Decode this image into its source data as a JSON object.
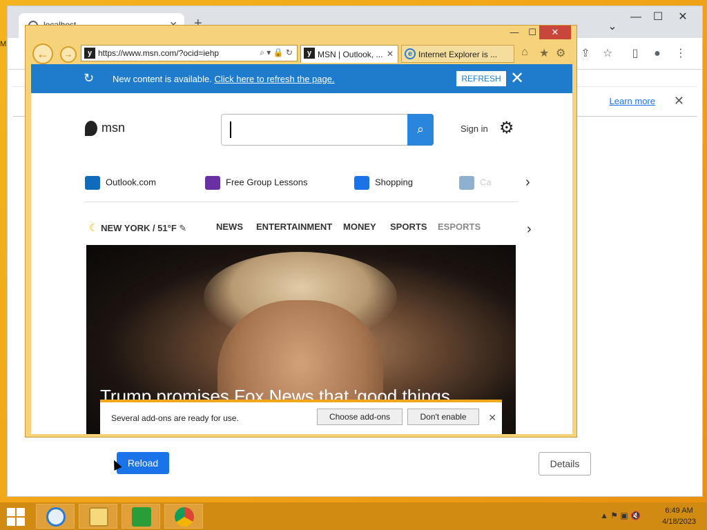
{
  "chrome": {
    "tab_title": "localhost",
    "infobar": {
      "learn_more": "Learn more"
    },
    "reload_label": "Reload",
    "details_label": "Details",
    "side_text": "M"
  },
  "ie": {
    "address": "https://www.msn.com/?ocid=iehp",
    "tabs": [
      {
        "label": "MSN | Outlook, ..."
      },
      {
        "label": "Internet Explorer is ..."
      }
    ],
    "notice": {
      "text": "New content is available.",
      "link": "Click here to refresh the page.",
      "refresh_button": "REFRESH"
    },
    "addons": {
      "text": "Several add-ons are ready for use.",
      "choose_button": "Choose add-ons",
      "dont_enable_button": "Don't enable"
    }
  },
  "msn": {
    "logo_text": "msn",
    "sign_in": "Sign in",
    "quicklinks": [
      {
        "label": "Outlook.com",
        "icon": "outlook-icon",
        "color": "#0f6cbd"
      },
      {
        "label": "Free Group Lessons",
        "icon": "graduation-cap-icon",
        "color": "#6b2fa5"
      },
      {
        "label": "Shopping",
        "icon": "cart-icon",
        "color": "#1a73e8"
      },
      {
        "label": "Ca",
        "icon": "car-icon",
        "color": "#8fb1d0"
      }
    ],
    "weather": "NEW YORK / 51°F",
    "nav": [
      "NEWS",
      "ENTERTAINMENT",
      "MONEY",
      "SPORTS",
      "ESPORTS"
    ],
    "headline": "Trump promises Fox News that 'good things"
  },
  "taskbar": {
    "time": "6:49 AM",
    "date": "4/18/2023"
  }
}
